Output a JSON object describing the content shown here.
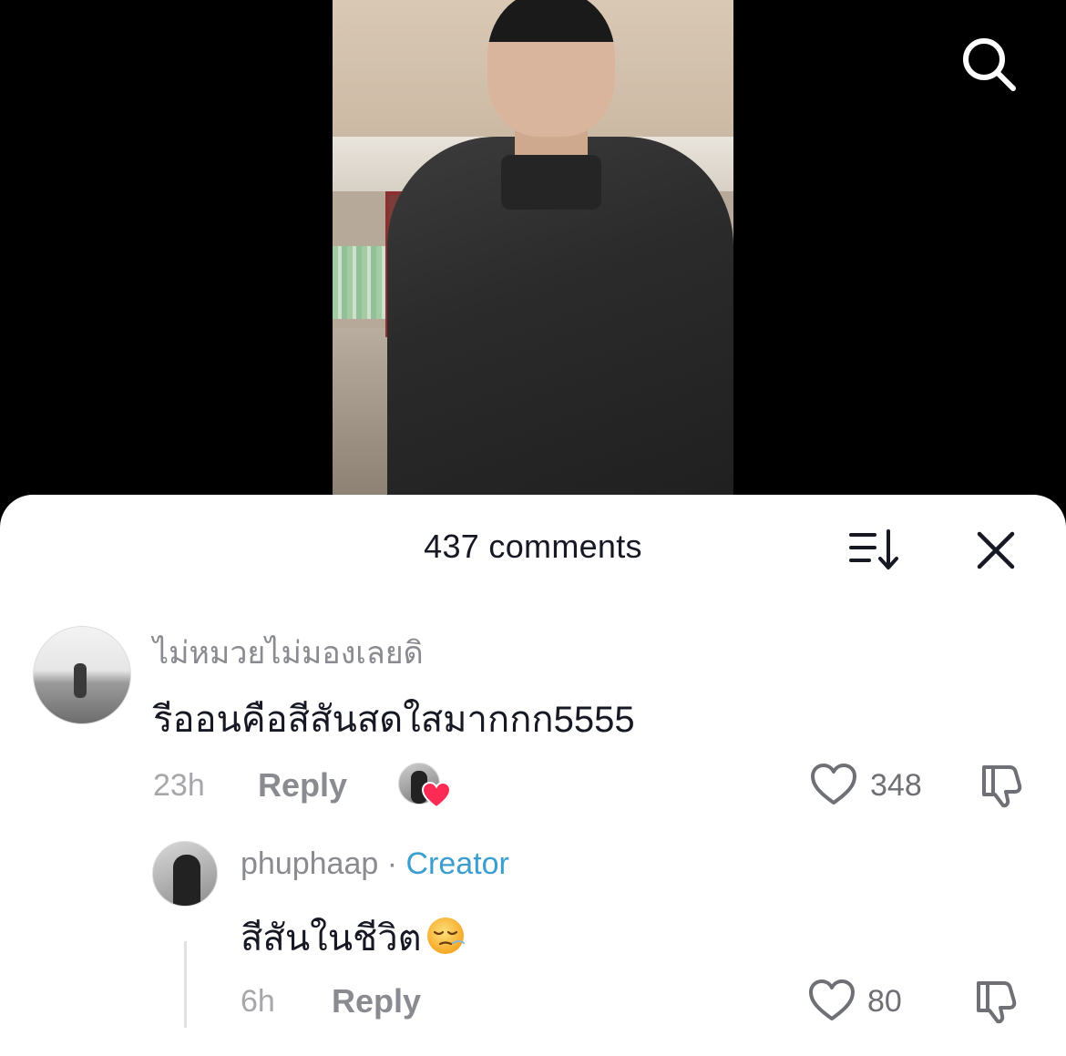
{
  "search": {
    "icon": "search-icon"
  },
  "comments": {
    "title": "437 comments",
    "sort_icon": "sort-icon",
    "close_icon": "close-icon"
  },
  "comment_1": {
    "username": "ไม่หมวยไม่มองเลยดิ",
    "text": "รีออนคือสีสันสดใสมากกก5555",
    "time": "23h",
    "reply_label": "Reply",
    "likes": "348",
    "creator_liked": true
  },
  "reply_1": {
    "username": "phuphaap",
    "separator": " · ",
    "badge": "Creator",
    "text": "สีสันในชีวิต",
    "emoji": "pensive-face",
    "time": "6h",
    "reply_label": "Reply",
    "likes": "80"
  },
  "colors": {
    "creator_badge": "#3a9fd0",
    "heart_badge": "#fe2c55",
    "text_primary": "#161823",
    "text_secondary": "#8a8b91"
  }
}
